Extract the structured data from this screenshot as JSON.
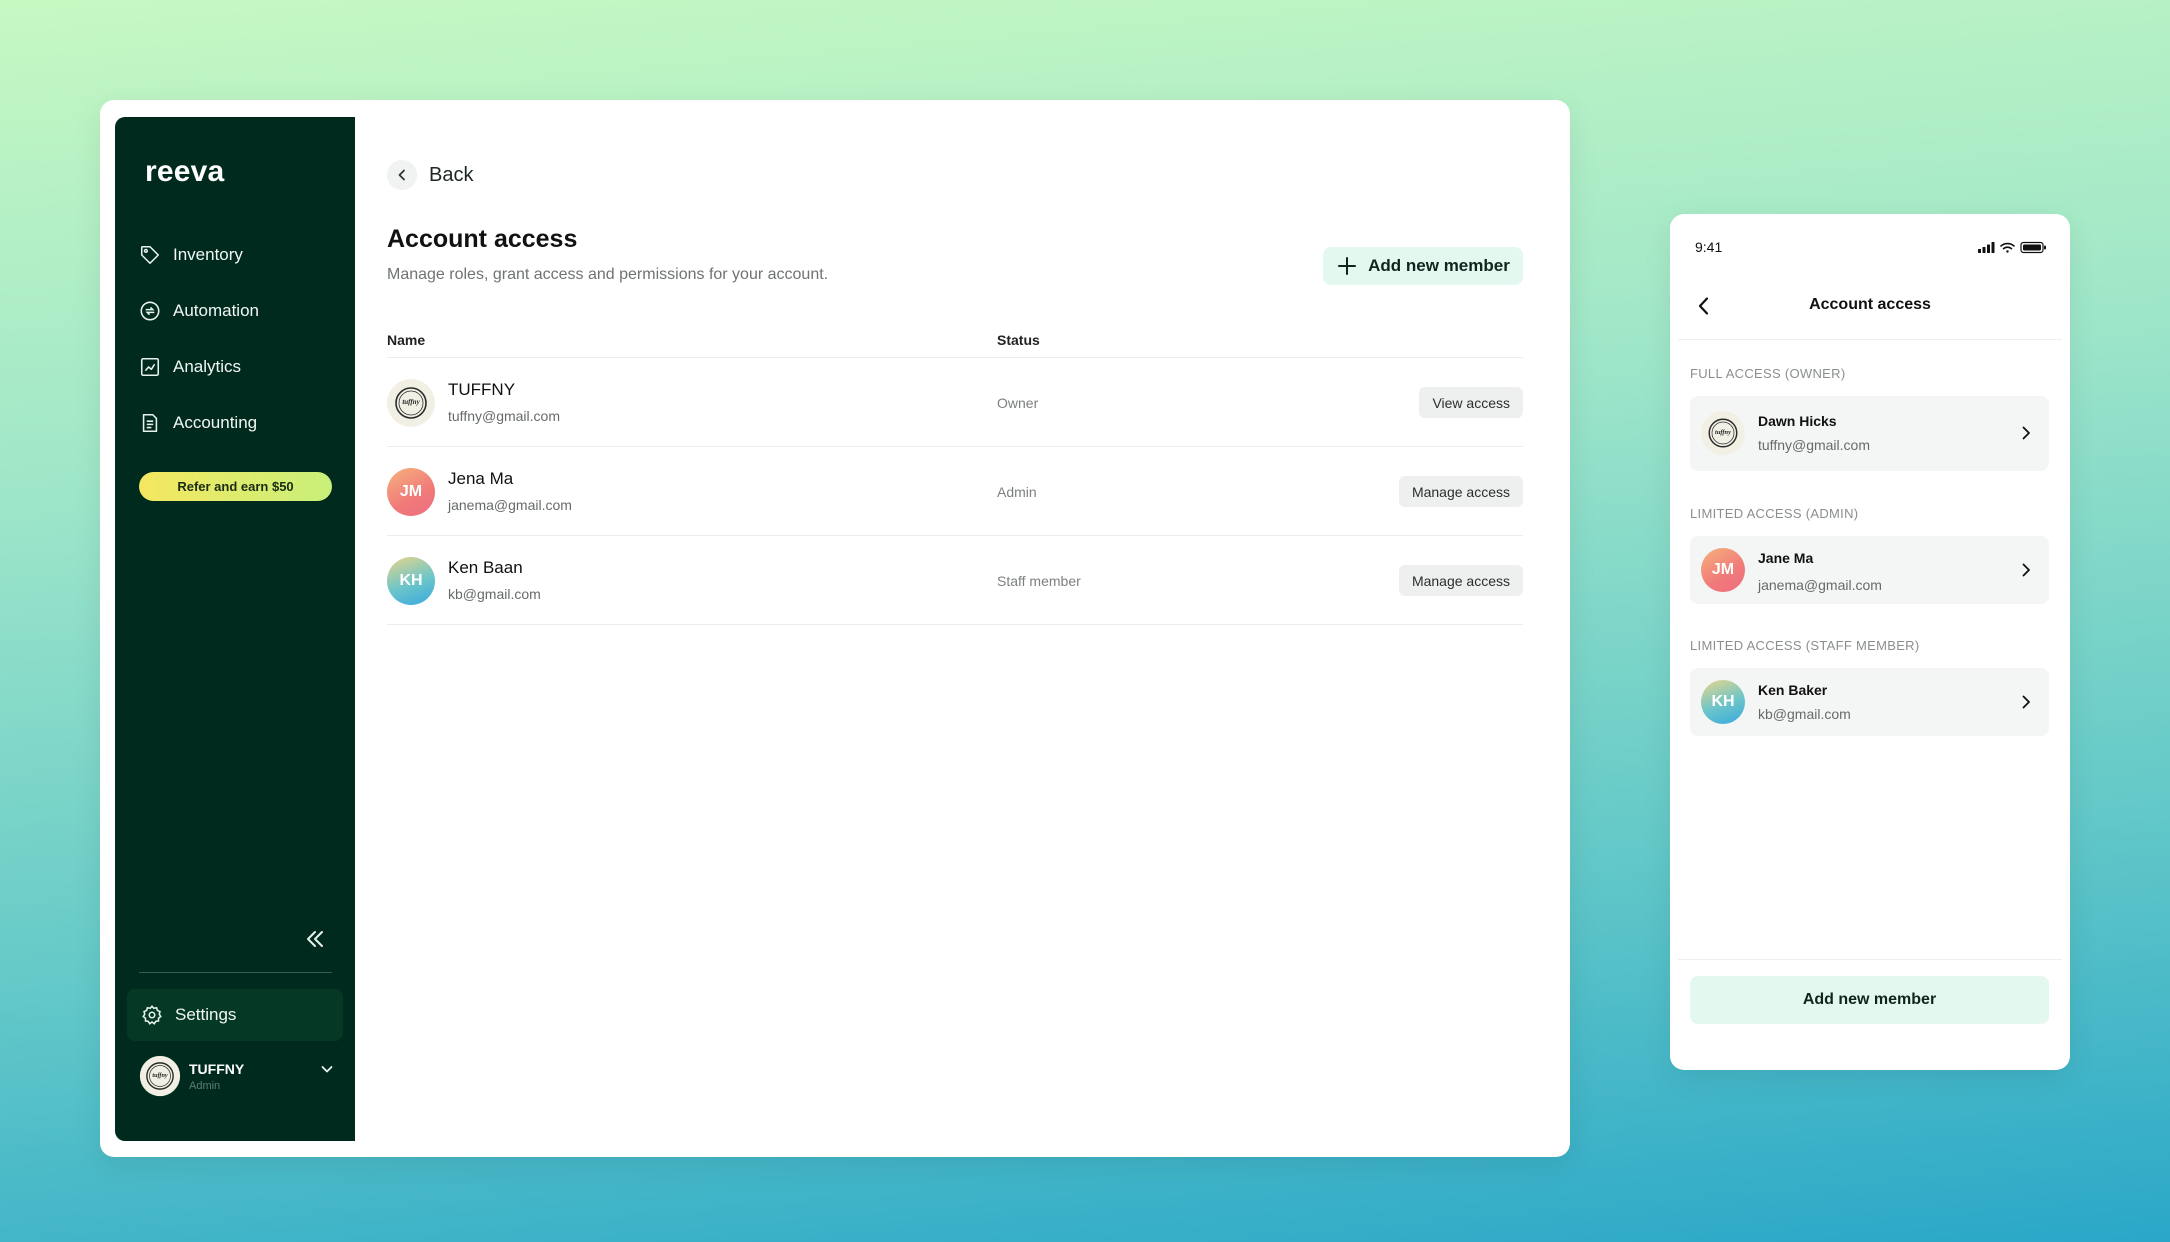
{
  "desktop": {
    "logo": "reeva",
    "nav": [
      {
        "label": "Inventory",
        "icon": "tag-icon"
      },
      {
        "label": "Automation",
        "icon": "automation-icon"
      },
      {
        "label": "Analytics",
        "icon": "analytics-icon"
      },
      {
        "label": "Accounting",
        "icon": "document-icon"
      }
    ],
    "refer_label": "Refer and earn $50",
    "settings_label": "Settings",
    "account": {
      "name": "TUFFNY",
      "role": "Admin"
    },
    "back_label": "Back",
    "title": "Account access",
    "subtitle": "Manage roles, grant access and permissions for your account.",
    "add_member_label": "Add new member",
    "table": {
      "headers": {
        "name": "Name",
        "status": "Status"
      },
      "rows": [
        {
          "name": "TUFFNY",
          "email": "tuffny@gmail.com",
          "status": "Owner",
          "action": "View access",
          "avatar": "logo"
        },
        {
          "name": "Jena Ma",
          "email": "janema@gmail.com",
          "status": "Admin",
          "action": "Manage access",
          "avatar": "initials",
          "initials": "JM"
        },
        {
          "name": "Ken Baan",
          "email": "kb@gmail.com",
          "status": "Staff member",
          "action": "Manage access",
          "avatar": "initials",
          "initials": "KH"
        }
      ]
    }
  },
  "phone": {
    "time": "9:41",
    "title": "Account access",
    "sections": [
      {
        "label": "FULL ACCESS (OWNER)",
        "member": {
          "name": "Dawn Hicks",
          "email": "tuffny@gmail.com",
          "avatar": "logo"
        }
      },
      {
        "label": "LIMITED ACCESS (ADMIN)",
        "member": {
          "name": "Jane Ma",
          "email": "janema@gmail.com",
          "initials": "JM"
        }
      },
      {
        "label": "LIMITED ACCESS (STAFF MEMBER)",
        "member": {
          "name": "Ken Baker",
          "email": "kb@gmail.com",
          "initials": "KH"
        }
      }
    ],
    "add_member_label": "Add new member"
  },
  "logo_text": "tuffny",
  "colors": {
    "sidebar_bg": "#012a1f",
    "accent_button_bg": "#e3f8ef",
    "refer_gradient_start": "#f5e760",
    "refer_gradient_end": "#c8f07a"
  }
}
